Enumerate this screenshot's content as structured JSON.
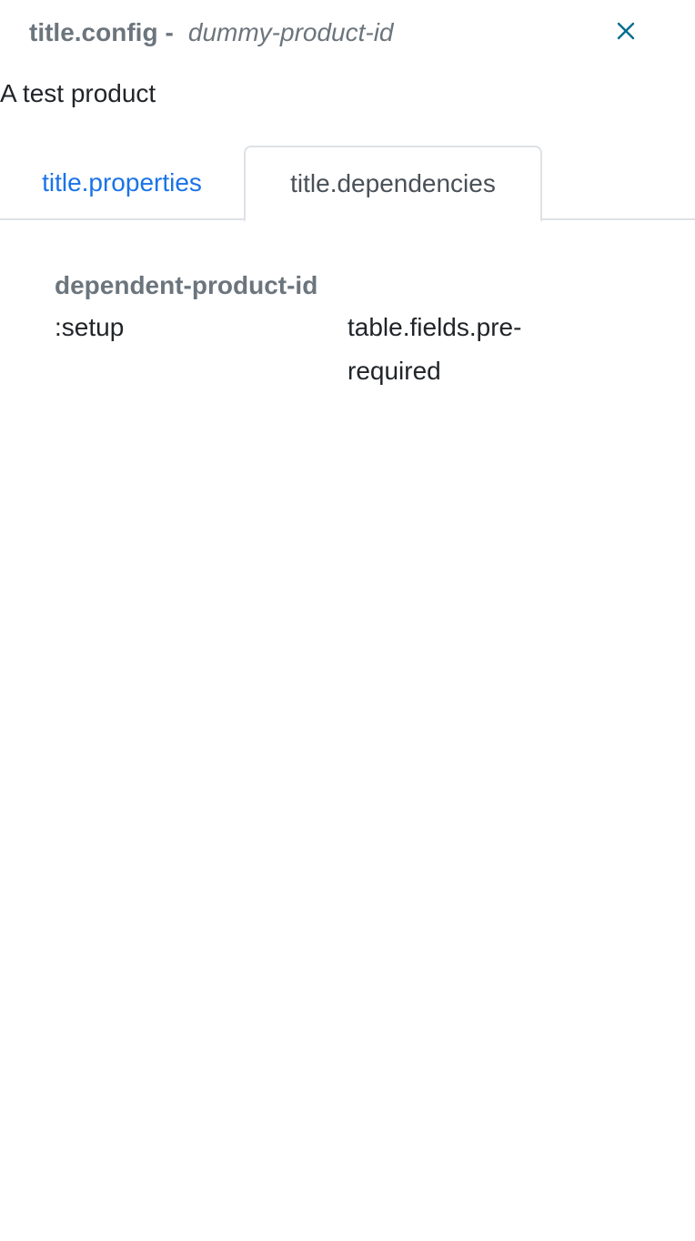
{
  "header": {
    "title": "title.config",
    "separator": "-",
    "product_id": "dummy-product-id",
    "close_icon": "close-icon",
    "close_color": "#006d8f"
  },
  "description": "A test product",
  "tabs": [
    {
      "label": "title.properties",
      "active": false
    },
    {
      "label": "title.dependencies",
      "active": true
    }
  ],
  "dependencies": {
    "header": "dependent-product-id",
    "rows": [
      {
        "name": ":setup",
        "type": "table.fields.pre-required"
      }
    ]
  },
  "colors": {
    "link": "#1a73e8",
    "muted": "#6c757d",
    "text": "#212529",
    "border": "#dee2e6"
  }
}
